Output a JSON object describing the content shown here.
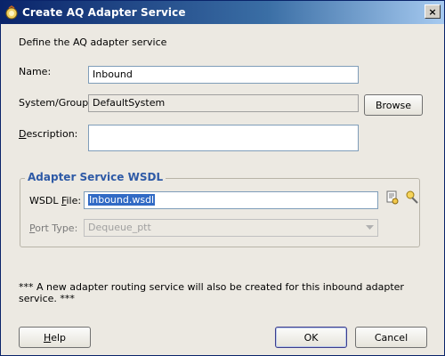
{
  "window": {
    "title": "Create AQ Adapter Service",
    "close_glyph": "×"
  },
  "intro": "Define the AQ adapter service",
  "form": {
    "name": {
      "label": "Name:",
      "value": "Inbound"
    },
    "system_group": {
      "label": "System/Group:",
      "value": "DefaultSystem",
      "browse_label": "Browse"
    },
    "description": {
      "label_prefix": "",
      "label_mnemonic": "D",
      "label_rest": "escription:",
      "value": ""
    }
  },
  "wsdl_group": {
    "title": "Adapter Service WSDL",
    "wsdl_file": {
      "label_prefix": "WSDL ",
      "label_mnemonic": "F",
      "label_rest": "ile:",
      "value": "Inbound.wsdl"
    },
    "port_type": {
      "label_prefix": "",
      "label_mnemonic": "P",
      "label_rest": "ort Type:",
      "value": "Dequeue_ptt"
    },
    "icons": [
      "wsdl-browse-icon",
      "wsdl-edit-icon"
    ]
  },
  "notice": "*** A new adapter routing service will also be created for this inbound adapter service. ***",
  "footer": {
    "help_mnemonic": "H",
    "help_rest": "elp",
    "ok_label": "OK",
    "cancel_label": "Cancel"
  },
  "colors": {
    "title_bar": "#0a246a",
    "group_title": "#2e5aa6",
    "selection": "#316ac5"
  }
}
